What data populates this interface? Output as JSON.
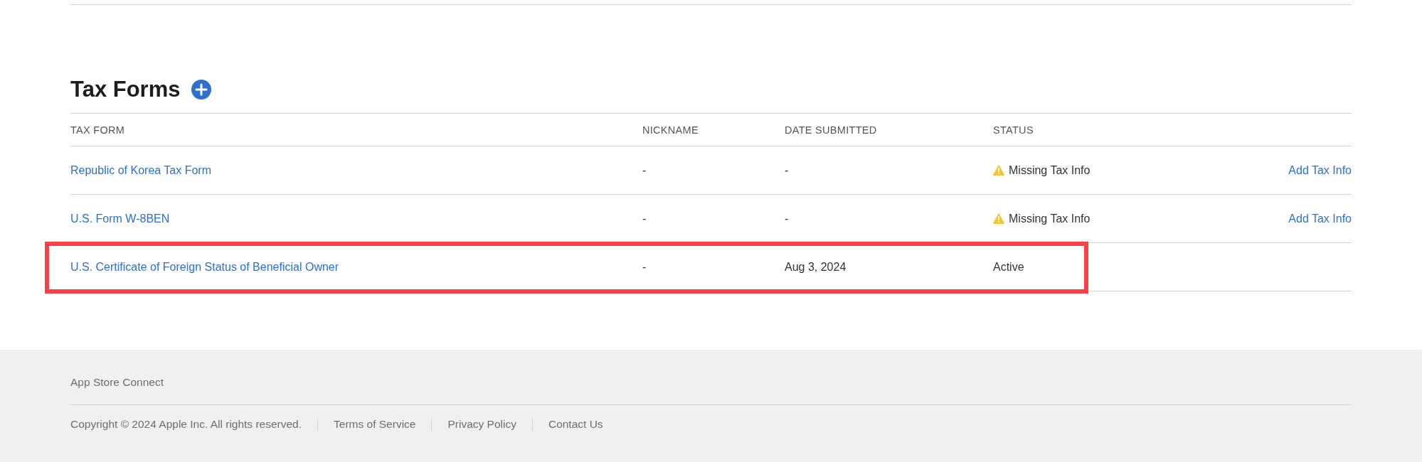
{
  "section": {
    "title": "Tax Forms"
  },
  "table": {
    "columns": [
      "TAX FORM",
      "NICKNAME",
      "DATE SUBMITTED",
      "STATUS"
    ],
    "rows": [
      {
        "form": "Republic of Korea Tax Form",
        "nickname": "-",
        "date_submitted": "-",
        "status": "Missing Tax Info",
        "warning": true,
        "action": "Add Tax Info",
        "highlighted": false
      },
      {
        "form": "U.S. Form W-8BEN",
        "nickname": "-",
        "date_submitted": "-",
        "status": "Missing Tax Info",
        "warning": true,
        "action": "Add Tax Info",
        "highlighted": false
      },
      {
        "form": "U.S. Certificate of Foreign Status of Beneficial Owner",
        "nickname": "-",
        "date_submitted": "Aug 3, 2024",
        "status": "Active",
        "warning": false,
        "highlighted": true
      }
    ]
  },
  "footer": {
    "title": "App Store Connect",
    "copyright": "Copyright © 2024 Apple Inc. All rights reserved.",
    "links": [
      "Terms of Service",
      "Privacy Policy",
      "Contact Us"
    ]
  }
}
